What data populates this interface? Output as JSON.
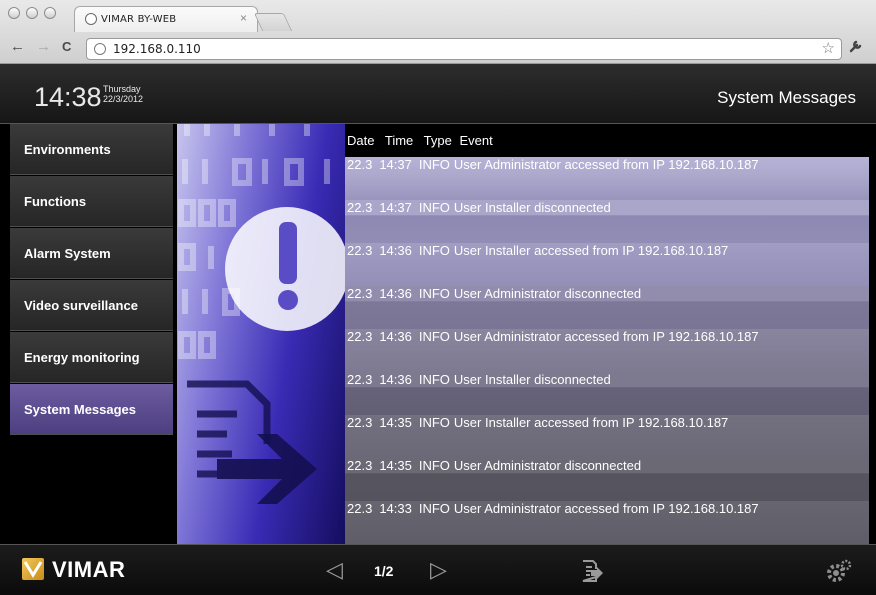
{
  "browser": {
    "tab_title": "VIMAR BY-WEB",
    "tab_close": "×",
    "url": "192.168.0.110",
    "back_glyph": "←",
    "forward_glyph": "→",
    "reload_glyph": "C",
    "star_glyph": "☆",
    "wrench_glyph": "🔧"
  },
  "header": {
    "time": "14:38",
    "weekday": "Thursday",
    "date": "22/3/2012",
    "title": "System Messages"
  },
  "sidebar": {
    "items": [
      {
        "label": "Environments"
      },
      {
        "label": "Functions"
      },
      {
        "label": "Alarm System"
      },
      {
        "label": "Video surveillance"
      },
      {
        "label": "Energy monitoring"
      },
      {
        "label": "System Messages",
        "active": true
      }
    ]
  },
  "messages": {
    "columns": {
      "date": "Date",
      "time": "Time",
      "type": "Type",
      "event": "Event"
    },
    "rows": [
      {
        "date": "22.3",
        "time": "14:37",
        "type": "INFO",
        "event": "User Administrator accessed from IP 192.168.10.187"
      },
      {
        "date": "22.3",
        "time": "14:37",
        "type": "INFO",
        "event": "User Installer disconnected"
      },
      {
        "date": "22.3",
        "time": "14:36",
        "type": "INFO",
        "event": "User Installer accessed from IP 192.168.10.187"
      },
      {
        "date": "22.3",
        "time": "14:36",
        "type": "INFO",
        "event": "User Administrator disconnected"
      },
      {
        "date": "22.3",
        "time": "14:36",
        "type": "INFO",
        "event": "User Administrator accessed from IP 192.168.10.187"
      },
      {
        "date": "22.3",
        "time": "14:36",
        "type": "INFO",
        "event": "User Installer disconnected"
      },
      {
        "date": "22.3",
        "time": "14:35",
        "type": "INFO",
        "event": "User Installer accessed from IP 192.168.10.187"
      },
      {
        "date": "22.3",
        "time": "14:35",
        "type": "INFO",
        "event": "User Administrator disconnected"
      },
      {
        "date": "22.3",
        "time": "14:33",
        "type": "INFO",
        "event": "User Administrator accessed from IP 192.168.10.187"
      }
    ]
  },
  "footer": {
    "brand": "VIMAR",
    "page_indicator": "1/2",
    "prev_glyph": "◁",
    "next_glyph": "▷",
    "icons": [
      "export-icon",
      "gear-icon"
    ]
  },
  "colors": {
    "active_menu": "#5c4d92",
    "art_gradient_dark": "#100a55",
    "art_gradient_light": "#c7c5ee"
  }
}
